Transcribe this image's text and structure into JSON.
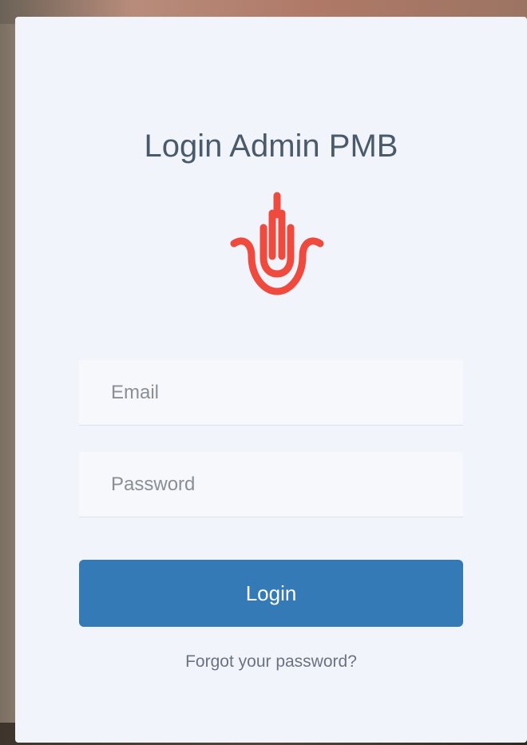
{
  "login_card": {
    "title": "Login Admin PMB",
    "logo_icon": "raised-hand-icon",
    "logo_color": "#f04a3e",
    "email_placeholder": "Email",
    "email_value": "",
    "password_placeholder": "Password",
    "password_value": "",
    "login_label": "Login",
    "login_color": "#337ab7",
    "forgot_label": "Forgot your password?"
  }
}
